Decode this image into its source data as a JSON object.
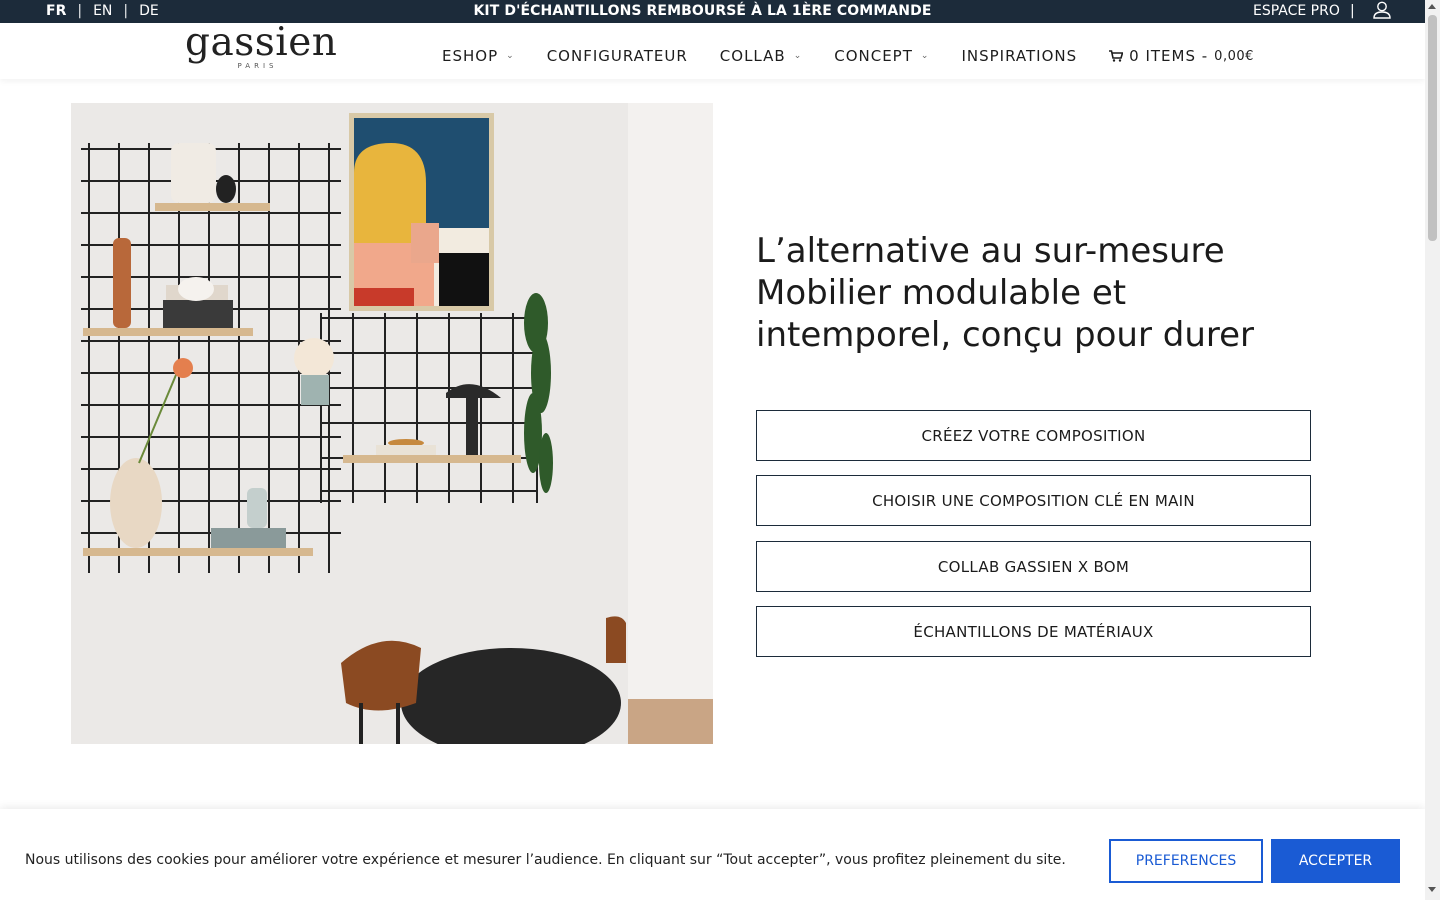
{
  "topbar": {
    "languages": [
      {
        "label": "FR",
        "active": true
      },
      {
        "label": "EN",
        "active": false
      },
      {
        "label": "DE",
        "active": false
      }
    ],
    "separator": "|",
    "promo": "KIT D'ÉCHANTILLONS REMBOURSÉ À LA 1ÈRE COMMANDE",
    "pro_link": "ESPACE PRO",
    "pro_separator": "|",
    "account_icon": "user-icon",
    "background_color": "#1c2b3a"
  },
  "header": {
    "logo": "gassien",
    "logo_sub": "PARIS",
    "nav": [
      {
        "label": "ESHOP",
        "has_dropdown": true
      },
      {
        "label": "CONFIGURATEUR",
        "has_dropdown": false
      },
      {
        "label": "COLLAB",
        "has_dropdown": true
      },
      {
        "label": "CONCEPT",
        "has_dropdown": true
      },
      {
        "label": "INSPIRATIONS",
        "has_dropdown": false
      }
    ],
    "cart": {
      "icon": "cart-icon",
      "label": "0 ITEMS -",
      "price": "0,00€"
    }
  },
  "hero": {
    "headline": "L’alternative au sur-mesure Mobilier modulable et intemporel, conçu pour durer",
    "buttons": [
      "CRÉEZ VOTRE COMPOSITION",
      "CHOISIR UNE COMPOSITION CLÉ EN MAIN",
      "COLLAB GASSIEN X BOM",
      "ÉCHANTILLONS DE MATÉRIAUX"
    ]
  },
  "cookie_banner": {
    "text": "Nous utilisons des cookies pour améliorer votre expérience et mesurer l’audience. En cliquant sur “Tout accepter”, vous profitez pleinement du site.",
    "preferences_button": "PREFERENCES",
    "accept_button": "ACCEPTER",
    "accent_color": "#1a5bd4"
  }
}
